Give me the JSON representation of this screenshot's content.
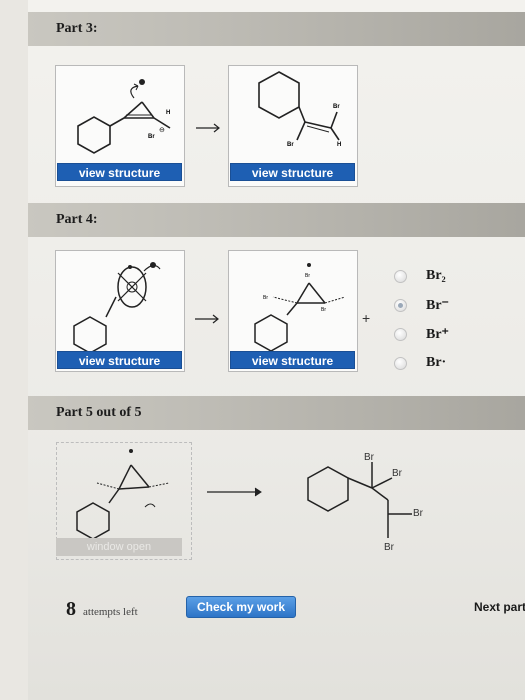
{
  "part3": {
    "title": "Part 3:",
    "view_structure_1": "view structure",
    "view_structure_2": "view structure",
    "atom_H_left": "H",
    "atom_Br_left": "Br",
    "atom_Br_right_top": "Br",
    "atom_Br_right_bottom": "Br",
    "atom_H_right": "H",
    "charge": "⊖"
  },
  "part4": {
    "title": "Part 4:",
    "view_structure_1": "view structure",
    "view_structure_2": "view structure",
    "plus": "+",
    "options": [
      {
        "label": "Br₂",
        "selected": false
      },
      {
        "label": "Br⁻",
        "selected": true
      },
      {
        "label": "Br⁺",
        "selected": false
      },
      {
        "label": "Br·",
        "selected": false
      }
    ],
    "atom_Br_top": "Br",
    "atom_Br_left": "Br",
    "atom_Br_right": "Br"
  },
  "part5": {
    "title": "Part 5 out of 5",
    "window_open": "window open",
    "product_Br_top": "Br",
    "product_Br_upper_right": "Br",
    "product_Br_lower_right": "Br",
    "product_Br_bottom": "Br"
  },
  "footer": {
    "attempts_count": "8",
    "attempts_text": "attempts left",
    "check_button": "Check my work",
    "next_part": "Next part"
  },
  "colors": {
    "button_blue": "#1e5fb3",
    "check_blue": "#2d74c7"
  }
}
